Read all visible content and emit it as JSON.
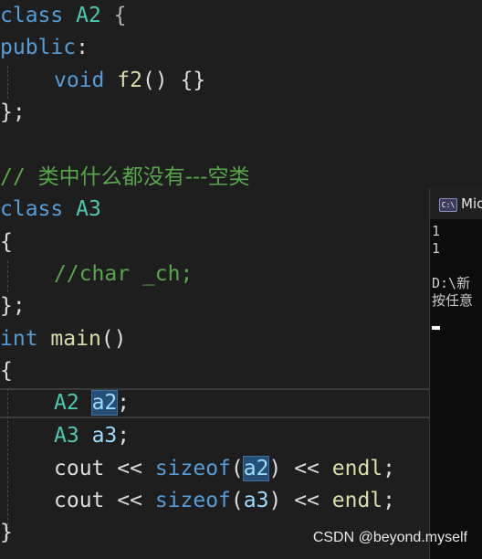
{
  "code": {
    "l1": {
      "kw": "class",
      "name": "A2",
      "brace": "{"
    },
    "l2": {
      "kw": "public",
      "colon": ":"
    },
    "l3": {
      "kw": "void",
      "fn": "f2",
      "paren": "()",
      "body": "{}"
    },
    "l4": {
      "text": "};"
    },
    "l5": {
      "comment_slash": "//",
      "comment_text": "类中什么都没有---空类"
    },
    "l6": {
      "kw": "class",
      "name": "A3"
    },
    "l7": {
      "text": "{"
    },
    "l8": {
      "comment": "//char _ch;"
    },
    "l9": {
      "text": "};"
    },
    "l10": {
      "kw": "int",
      "fn": "main",
      "paren": "()"
    },
    "l11": {
      "text": "{"
    },
    "l12": {
      "type": "A2",
      "var": "a2",
      "semi": ";"
    },
    "l13": {
      "type": "A3",
      "var": "a3",
      "semi": ";"
    },
    "l14": {
      "cout": "cout",
      "op1": "<<",
      "fn": "sizeof",
      "lp": "(",
      "arg": "a2",
      "rp": ")",
      "op2": "<<",
      "endl": "endl",
      "semi": ";"
    },
    "l15": {
      "cout": "cout",
      "op1": "<<",
      "fn": "sizeof",
      "lp": "(",
      "arg": "a3",
      "rp": ")",
      "op2": "<<",
      "endl": "endl",
      "semi": ";"
    },
    "l16": {
      "text": "}"
    }
  },
  "console": {
    "icon": "C:\\",
    "title": "Mic",
    "lines": "1\n1\n\nD:\\新\n按任意"
  },
  "watermark": "CSDN @beyond.myself",
  "colors": {
    "keyword": "#569cd6",
    "type": "#4ec9b0",
    "function": "#dcdcaa",
    "comment": "#57a64a",
    "variable": "#9cdcfe",
    "background": "#1e1e1e",
    "selection": "#264f78"
  }
}
